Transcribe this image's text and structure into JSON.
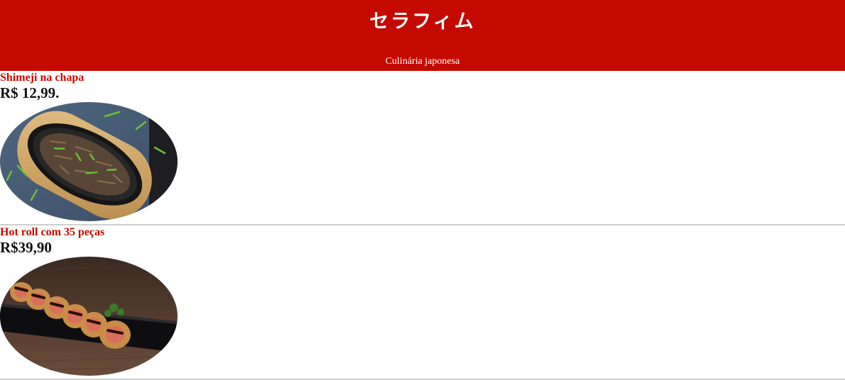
{
  "header": {
    "title": "セラフィム",
    "subtitle": "Culinária japonesa",
    "background_color": "#c40a00"
  },
  "menu": [
    {
      "name": "Shimeji na chapa",
      "price": "R$ 12,99.",
      "image": "shimeji-hot-plate-photo"
    },
    {
      "name": "Hot roll com 35 peças",
      "price": "R$39,90",
      "image": "hot-roll-sushi-photo"
    }
  ],
  "colors": {
    "accent": "#c40a00",
    "divider": "#cfcfcf"
  }
}
